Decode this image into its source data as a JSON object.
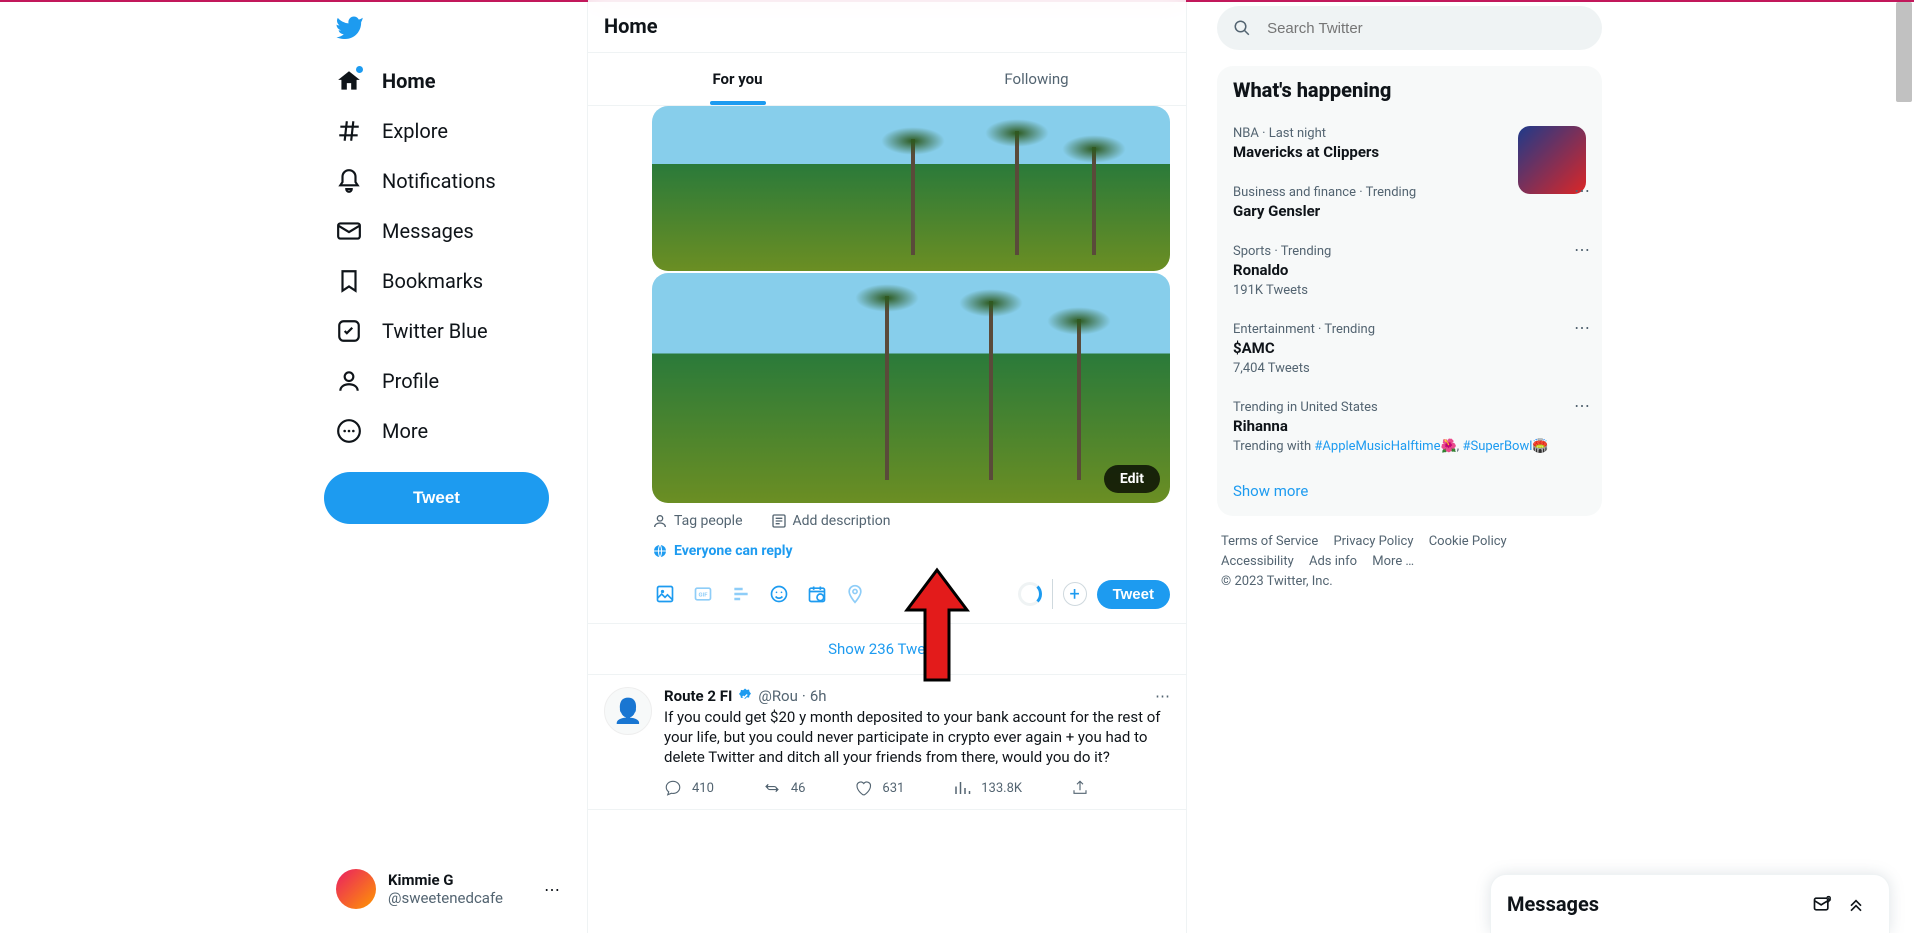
{
  "header": {
    "title": "Home"
  },
  "tabs": {
    "for_you": "For you",
    "following": "Following"
  },
  "nav": {
    "home": "Home",
    "explore": "Explore",
    "notifications": "Notifications",
    "messages": "Messages",
    "bookmarks": "Bookmarks",
    "twitter_blue": "Twitter Blue",
    "profile": "Profile",
    "more": "More"
  },
  "tweet_button": "Tweet",
  "account": {
    "name": "Kimmie G",
    "handle": "@sweetenedcafe"
  },
  "compose": {
    "edit_label": "Edit",
    "tag_people": "Tag people",
    "add_description": "Add description",
    "reply_setting": "Everyone can reply",
    "tweet_small": "Tweet"
  },
  "show_new": "Show 236 Tweets",
  "post": {
    "name": "Route 2 FI",
    "handle": "@Rou",
    "time": "6h",
    "text": "If you could get $20         y month deposited to your bank account for the rest of your life, but you could never participate in crypto ever again + you had to delete Twitter and ditch all your friends from there, would you do it?",
    "replies": "410",
    "retweets": "46",
    "likes": "631",
    "views": "133.8K"
  },
  "search": {
    "placeholder": "Search Twitter"
  },
  "whats_happening": {
    "title": "What's happening",
    "items": [
      {
        "cat": "NBA · Last night",
        "name": "Mavericks at Clippers",
        "thumb": true
      },
      {
        "cat": "Business and finance · Trending",
        "name": "Gary Gensler"
      },
      {
        "cat": "Sports · Trending",
        "name": "Ronaldo",
        "sub": "191K Tweets"
      },
      {
        "cat": "Entertainment · Trending",
        "name": "$AMC",
        "sub": "7,404 Tweets"
      },
      {
        "cat": "Trending in United States",
        "name": "Rihanna",
        "trending_with": "Trending with ",
        "h1": "#AppleMusicHalftime",
        "e1": "🌺",
        "sep": ", ",
        "h2": "#SuperBowl",
        "e2": "🏟️"
      }
    ],
    "show_more": "Show more"
  },
  "footer": {
    "tos": "Terms of Service",
    "privacy": "Privacy Policy",
    "cookie": "Cookie Policy",
    "accessibility": "Accessibility",
    "ads": "Ads info",
    "more": "More …",
    "copyright": "© 2023 Twitter, Inc."
  },
  "messages_dock": "Messages"
}
